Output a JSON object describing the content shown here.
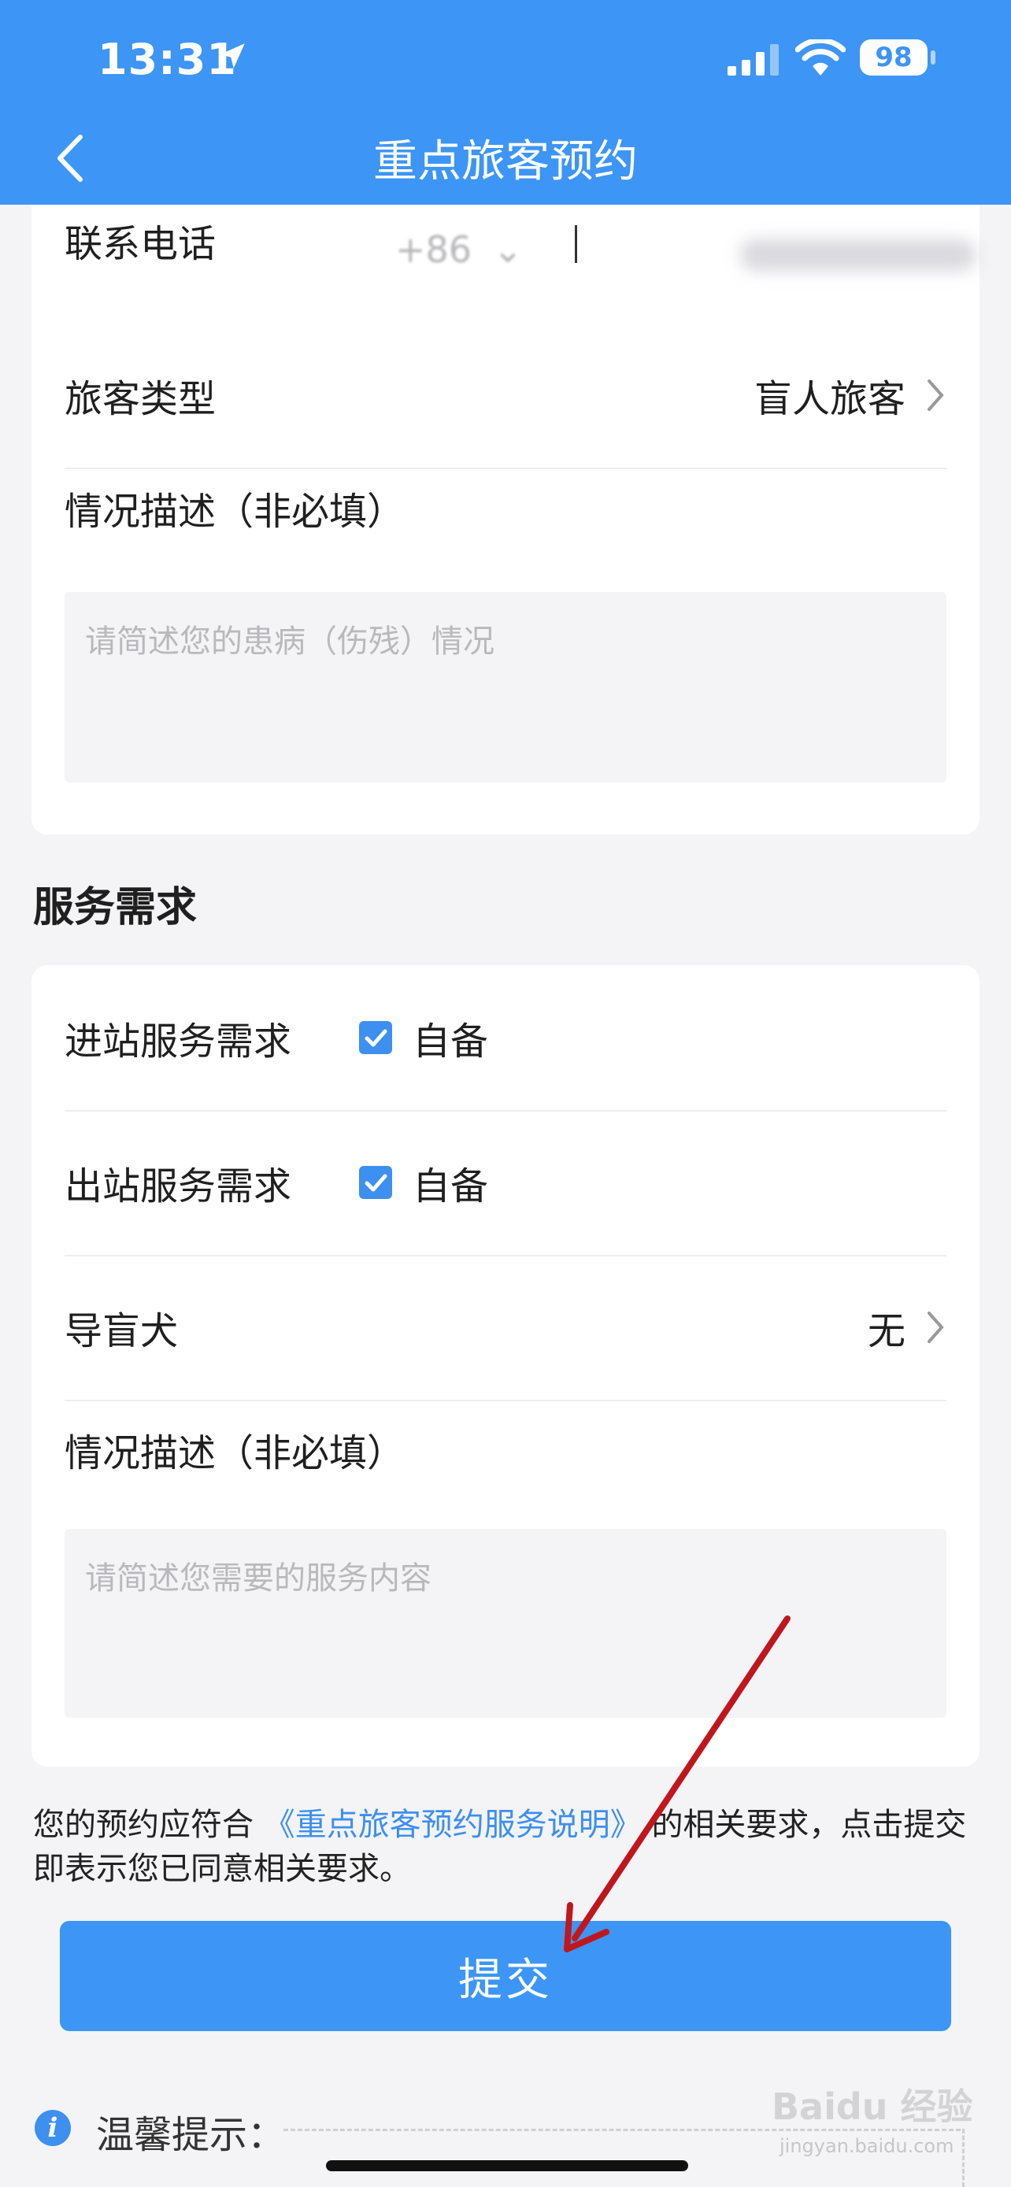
{
  "status_bar": {
    "time": "13:31",
    "battery": "98"
  },
  "nav": {
    "title": "重点旅客预约"
  },
  "passenger_card": {
    "phone_label": "联系电话",
    "phone_code": "+86",
    "passenger_type_label": "旅客类型",
    "passenger_type_value": "盲人旅客",
    "description_label": "情况描述（非必填）",
    "description_placeholder": "请简述您的患病（伤残）情况"
  },
  "service": {
    "section_title": "服务需求",
    "inbound_label": "进站服务需求",
    "inbound_option": "自备",
    "outbound_label": "出站服务需求",
    "outbound_option": "自备",
    "guide_dog_label": "导盲犬",
    "guide_dog_value": "无",
    "description_label": "情况描述（非必填）",
    "description_placeholder": "请简述您需要的服务内容"
  },
  "notice": {
    "prefix": "您的预约应符合",
    "link": "《重点旅客预约服务说明》",
    "suffix": "的相关要求，点击提交即表示您已同意相关要求。"
  },
  "submit_label": "提交",
  "tips": {
    "icon": "i",
    "label": "温馨提示："
  },
  "watermark": {
    "main": "Baidu 经验",
    "sub": "jingyan.baidu.com"
  },
  "colors": {
    "primary": "#3d95f5",
    "annotation_arrow": "#c0171d"
  }
}
